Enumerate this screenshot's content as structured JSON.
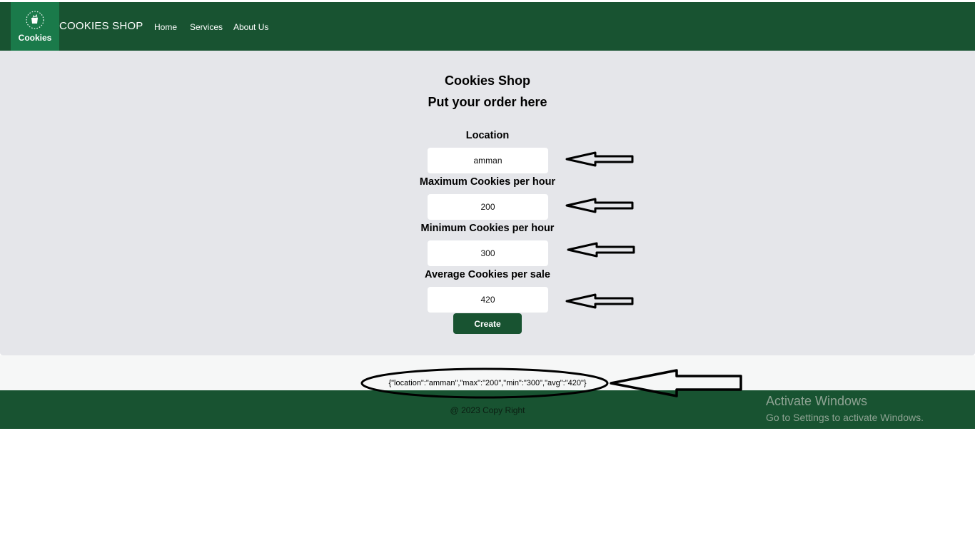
{
  "navbar": {
    "logo_text": "Cookies",
    "brand": "COOKIES SHOP",
    "links": [
      "Home",
      "Services",
      "About Us"
    ]
  },
  "form": {
    "title": "Cookies Shop",
    "subtitle": "Put your order here",
    "location_label": "Location",
    "location_value": "amman",
    "max_label": "Maximum Cookies per hour",
    "max_value": "200",
    "min_label": "Minimum Cookies per hour",
    "min_value": "300",
    "avg_label": "Average Cookies per sale",
    "avg_value": "420",
    "create_label": "Create"
  },
  "output": {
    "json_text": "{\"location\":\"amman\",\"max\":\"200\",\"min\":\"300\",\"avg\":\"420\"}"
  },
  "footer": {
    "copyright": "@ 2023 Copy Right"
  },
  "watermark": {
    "line1": "Activate Windows",
    "line2": "Go to Settings to activate Windows."
  },
  "colors": {
    "primary_green": "#185331",
    "logo_green": "#1a7a4a",
    "main_bg": "#e5e6ea"
  }
}
